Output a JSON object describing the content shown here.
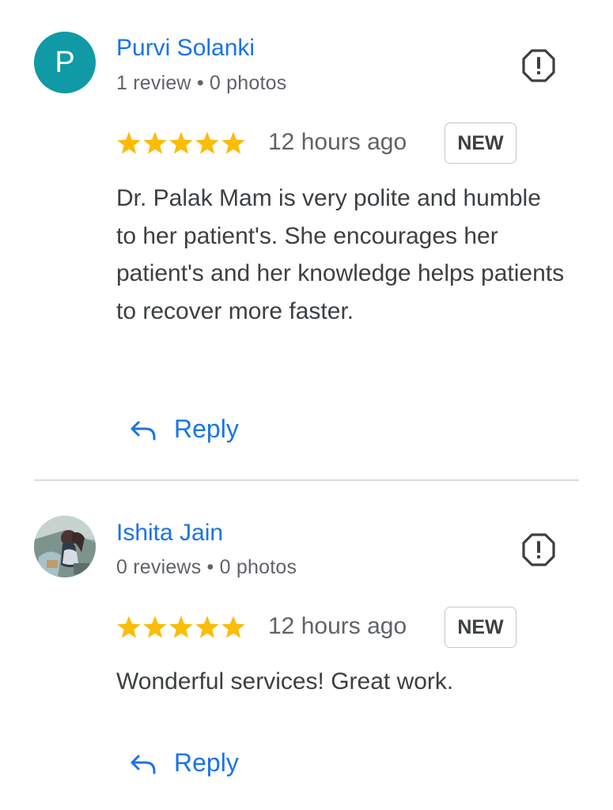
{
  "colors": {
    "link": "#1a73e8",
    "star": "#fbbc04",
    "avatar_bg": "#0f9aa5",
    "text": "#3c4043",
    "secondary_text": "#5f6368",
    "divider": "#dadce0"
  },
  "reviews": [
    {
      "avatar_letter": "P",
      "author": "Purvi Solanki",
      "meta": "1 review • 0 photos",
      "rating": 5,
      "time": "12 hours ago",
      "badge": "NEW",
      "text": "Dr. Palak Mam is very polite and humble to her patient's. She encourages her patient's and her knowledge helps patients to recover more faster.",
      "reply_label": "Reply",
      "flag_icon": "report-flag-icon"
    },
    {
      "avatar_letter": "",
      "author": "Ishita Jain",
      "meta": "0 reviews • 0 photos",
      "rating": 5,
      "time": "12 hours ago",
      "badge": "NEW",
      "text": "Wonderful services! Great work.",
      "reply_label": "Reply",
      "flag_icon": "report-flag-icon"
    }
  ]
}
